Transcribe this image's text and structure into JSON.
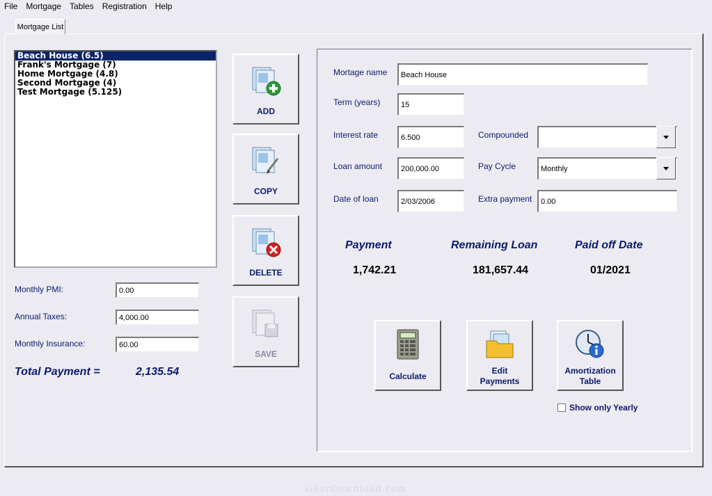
{
  "menu": [
    "File",
    "Mortgage",
    "Tables",
    "Registration",
    "Help"
  ],
  "tab": {
    "label": "Mortgage List"
  },
  "mortgage_list": {
    "items": [
      {
        "label": "Beach House (6.5)",
        "selected": true
      },
      {
        "label": "Frank's Mortgage (7)",
        "selected": false
      },
      {
        "label": "Home Mortgage (4.8)",
        "selected": false
      },
      {
        "label": "Second Mortgage (4)",
        "selected": false
      },
      {
        "label": "Test Mortgage (5.125)",
        "selected": false
      }
    ]
  },
  "extras": {
    "monthly_pmi": {
      "label": "Monthly PMI:",
      "value": "0.00"
    },
    "annual_taxes": {
      "label": "Annual Taxes:",
      "value": "4,000.00"
    },
    "monthly_insurance": {
      "label": "Monthly Insurance:",
      "value": "60.00"
    },
    "total_label": "Total Payment =",
    "total_value": "2,135.54"
  },
  "actions": {
    "add": "ADD",
    "copy": "COPY",
    "delete": "DELETE",
    "save": "SAVE"
  },
  "form": {
    "mortgage_name": {
      "label": "Mortage name",
      "value": "Beach House"
    },
    "term": {
      "label": "Term (years)",
      "value": "15"
    },
    "interest_rate": {
      "label": "Interest rate",
      "value": "6.500"
    },
    "compounded": {
      "label": "Compounded",
      "value": ""
    },
    "loan_amount": {
      "label": "Loan amount",
      "value": "200,000.00"
    },
    "pay_cycle": {
      "label": "Pay Cycle",
      "value": "Monthly"
    },
    "date_of_loan": {
      "label": "Date of loan",
      "value": "2/03/2006"
    },
    "extra_payment": {
      "label": "Extra payment",
      "value": "0.00"
    }
  },
  "results": {
    "payment": {
      "label": "Payment",
      "value": "1,742.21"
    },
    "remaining": {
      "label": "Remaining Loan",
      "value": "181,657.44"
    },
    "paid_off": {
      "label": "Paid off Date",
      "value": "01/2021"
    }
  },
  "tools": {
    "calculate": "Calculate",
    "edit_payments_1": "Edit",
    "edit_payments_2": "Payments",
    "amort_1": "Amortization",
    "amort_2": "Table",
    "show_yearly": "Show only Yearly"
  },
  "watermark": "GearDownload.com"
}
